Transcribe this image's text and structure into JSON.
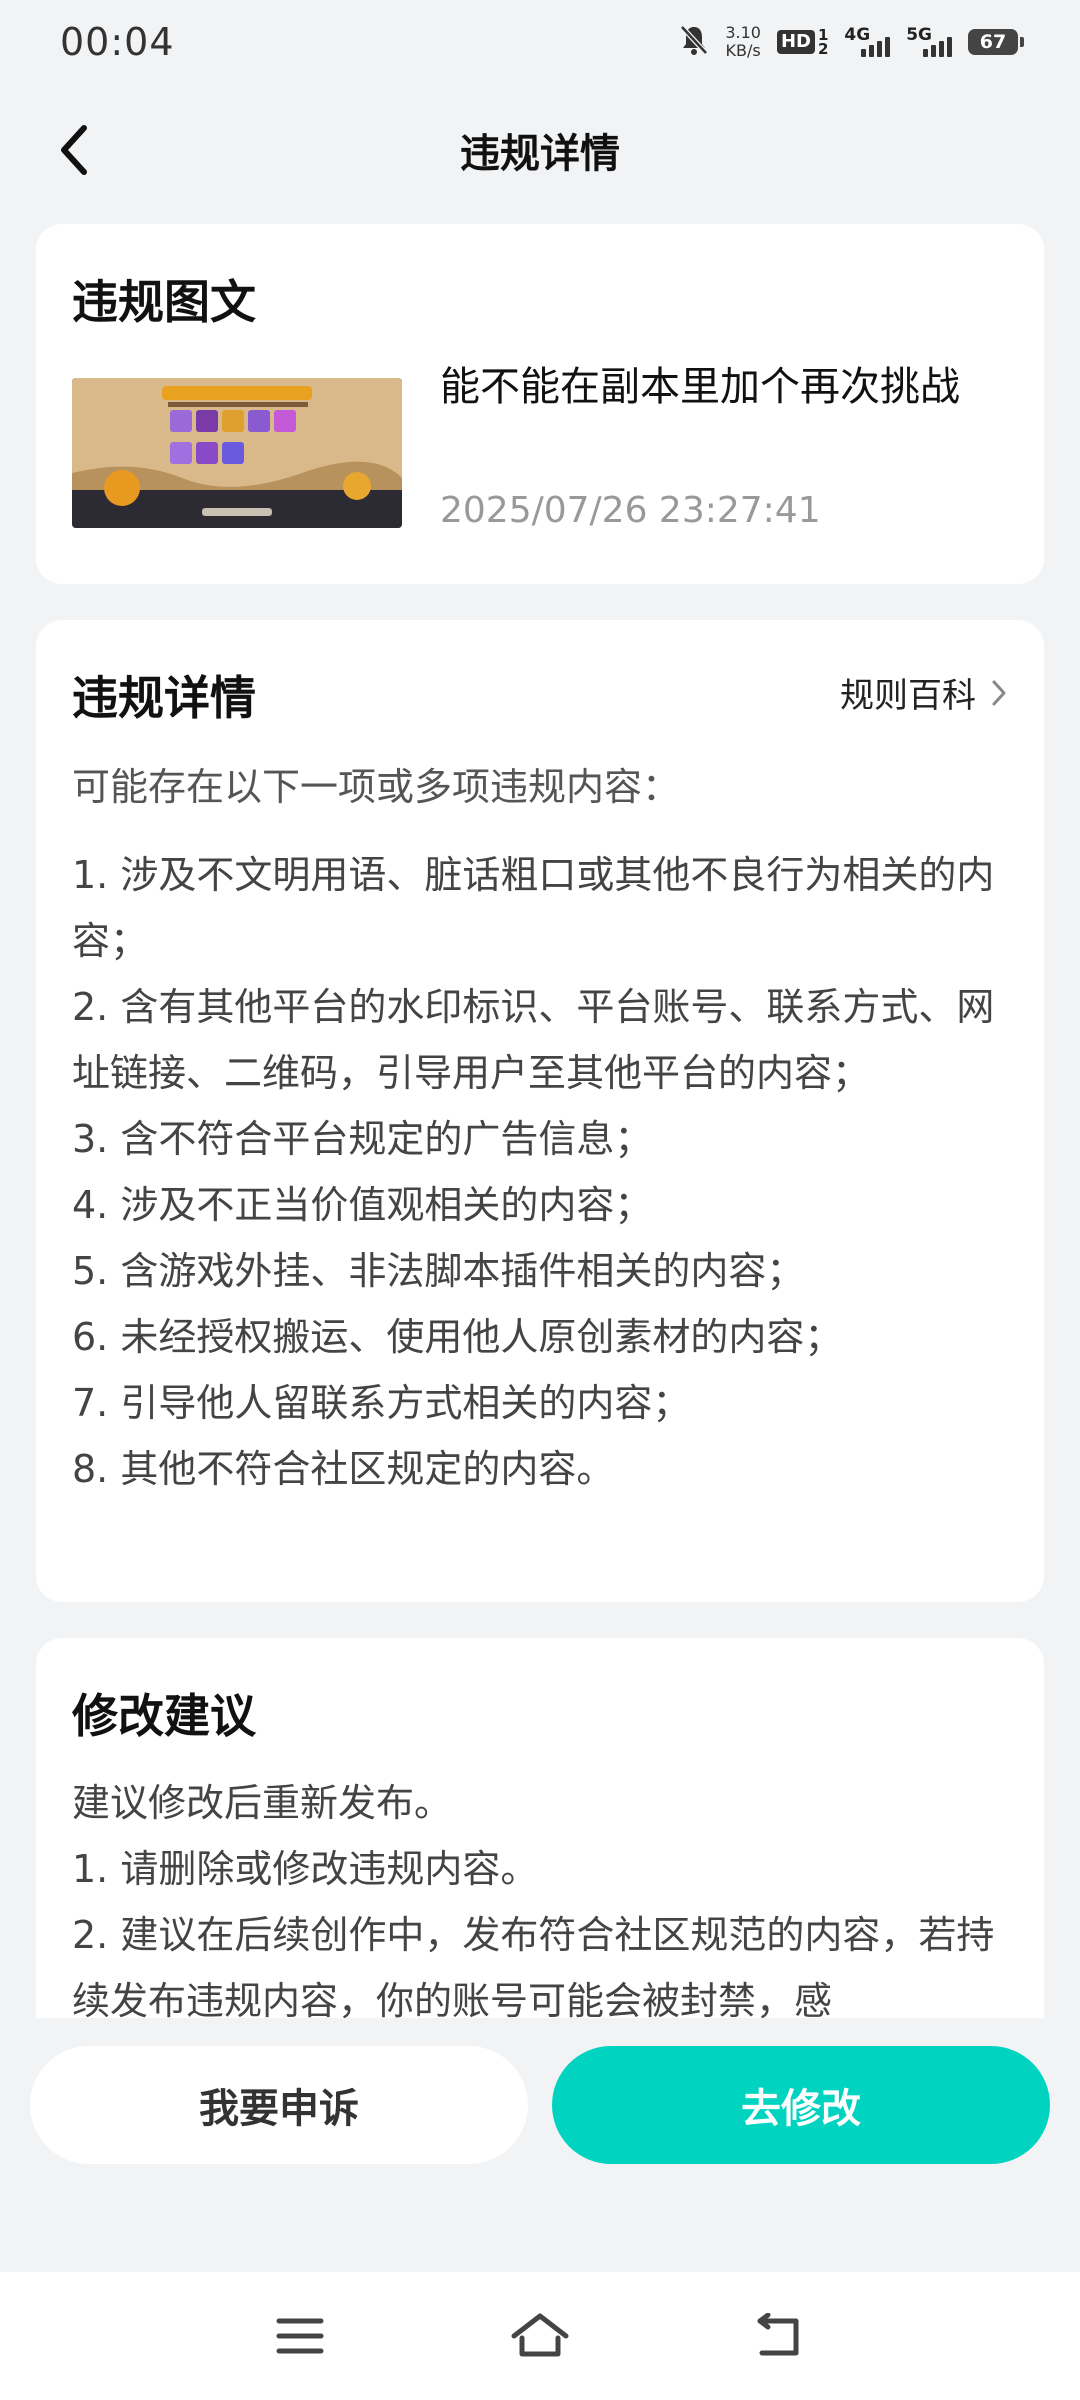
{
  "status_bar": {
    "time": "00:04",
    "speed_value": "3.10",
    "speed_unit": "KB/s",
    "hd_label": "HD",
    "hd_top": "1",
    "hd_bottom": "2",
    "net1": "4G",
    "net2": "5G",
    "battery": "67"
  },
  "header": {
    "title": "违规详情"
  },
  "post_card": {
    "title": "违规图文",
    "post_text": "能不能在副本里加个再次挑战",
    "post_date": "2025/07/26 23:27:41"
  },
  "details_card": {
    "title": "违规详情",
    "rules_link": "规则百科",
    "intro": "可能存在以下一项或多项违规内容：",
    "items": [
      "1. 涉及不文明用语、脏话粗口或其他不良行为相关的内容；",
      "2. 含有其他平台的水印标识、平台账号、联系方式、网址链接、二维码，引导用户至其他平台的内容；",
      "3. 含不符合平台规定的广告信息；",
      "4. 涉及不正当价值观相关的内容；",
      "5. 含游戏外挂、非法脚本插件相关的内容；",
      "6. 未经授权搬运、使用他人原创素材的内容；",
      "7. 引导他人留联系方式相关的内容；",
      "8. 其他不符合社区规定的内容。"
    ]
  },
  "suggest_card": {
    "title": "修改建议",
    "lines": [
      "建议修改后重新发布。",
      "1. 请删除或修改违规内容。",
      "2. 建议在后续创作中，发布符合社区规范的内容，若持续发布违规内容，你的账号可能会被封禁，感"
    ]
  },
  "actions": {
    "appeal": "我要申诉",
    "modify": "去修改"
  },
  "colors": {
    "accent": "#00d4c0",
    "background": "#f2f3f5",
    "card": "#ffffff"
  },
  "icons": {
    "back": "chevron-left-icon",
    "rules": "chevron-right-icon",
    "nav_menu": "menu-icon",
    "nav_home": "home-icon",
    "nav_back": "back-icon"
  }
}
